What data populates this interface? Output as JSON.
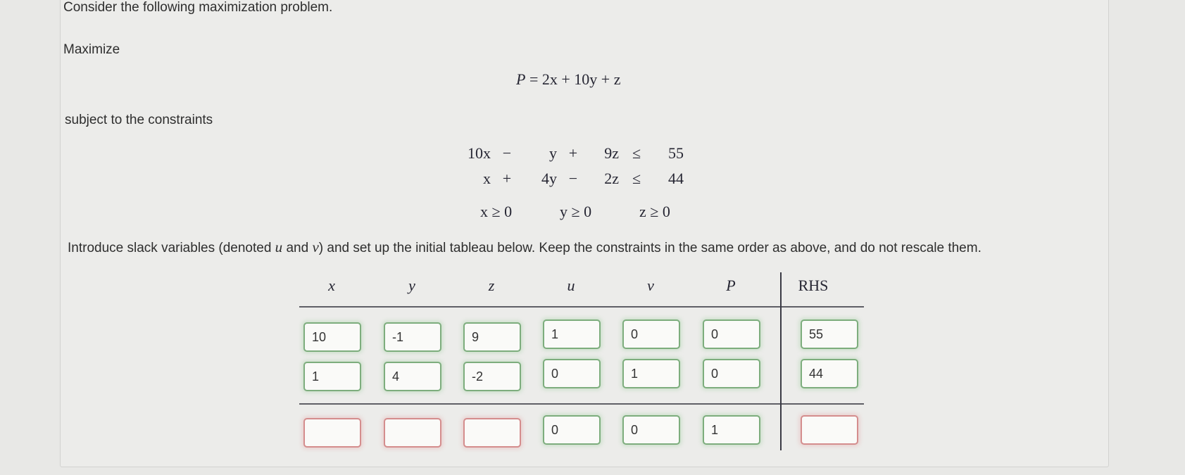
{
  "intro": "Consider the following maximization problem.",
  "maximize_label": "Maximize",
  "objective": {
    "lhs": "P",
    "rhs_terms": [
      "2x",
      "10y",
      "z"
    ],
    "text": "P = 2x + 10y + z"
  },
  "subject_label": "subject to the constraints",
  "constraints": [
    {
      "t1": "10x",
      "op1": "−",
      "t2": "y",
      "op2": "+",
      "t3": "9z",
      "rel": "≤",
      "rhs": "55"
    },
    {
      "t1": "x",
      "op1": "+",
      "t2": "4y",
      "op2": "−",
      "t3": "2z",
      "rel": "≤",
      "rhs": "44"
    }
  ],
  "nonnegativity": [
    "x ≥ 0",
    "y ≥ 0",
    "z ≥ 0"
  ],
  "instruction": {
    "part1": "Introduce slack variables (denoted ",
    "u": "u",
    "part2": " and ",
    "v": "v",
    "part3": ") and set up the initial tableau below. Keep the constraints in the same order as above, and do not rescale them."
  },
  "tableau": {
    "headers": [
      "x",
      "y",
      "z",
      "u",
      "v",
      "P",
      "RHS"
    ],
    "rows": [
      [
        "10",
        "-1",
        "9",
        "1",
        "0",
        "0",
        "55"
      ],
      [
        "1",
        "4",
        "-2",
        "0",
        "1",
        "0",
        "44"
      ],
      [
        "",
        "",
        "",
        "0",
        "0",
        "1",
        ""
      ]
    ],
    "cell_status": [
      [
        "correct",
        "correct",
        "correct",
        "correct",
        "correct",
        "correct",
        "correct"
      ],
      [
        "correct",
        "correct",
        "correct",
        "correct",
        "correct",
        "correct",
        "correct"
      ],
      [
        "incorrect",
        "incorrect",
        "incorrect",
        "correct",
        "correct",
        "correct",
        "incorrect"
      ]
    ],
    "colors": {
      "correct": "#7dad7d",
      "incorrect": "#d48d8d"
    }
  }
}
